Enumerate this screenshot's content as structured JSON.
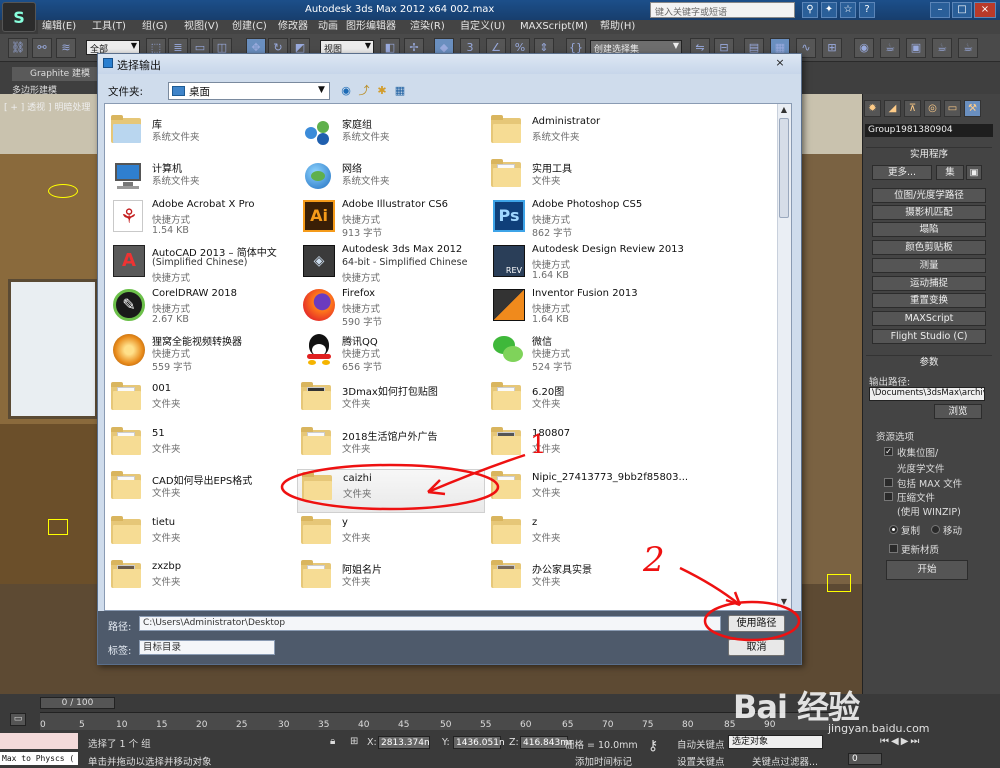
{
  "window": {
    "title": "Autodesk 3ds Max  2012 x64     002.max",
    "search_placeholder": "键入关键字或短语"
  },
  "menubar": {
    "items": [
      "编辑(E)",
      "工具(T)",
      "组(G)",
      "视图(V)",
      "创建(C)",
      "修改器",
      "动画",
      "图形编辑器",
      "渲染(R)",
      "自定义(U)",
      "MAXScript(M)",
      "帮助(H)"
    ]
  },
  "toolbar": {
    "selection_filter": "全部",
    "ref_coord": "视图",
    "named_selection": "创建选择集"
  },
  "ribbon": {
    "graphite_tab": "Graphite 建模",
    "poly_modeling": "多边形建模"
  },
  "viewport": {
    "label": "[ + ] 透视 ] 明暗处理"
  },
  "command_panel": {
    "object_name": "Group1981380904",
    "utilities_title": "实用程序",
    "more_button": "更多...",
    "sets_button": "集",
    "utility_buttons": [
      "位图/光度学路径",
      "摄影机匹配",
      "塌陷",
      "颜色剪贴板",
      "测量",
      "运动捕捉",
      "重置变换",
      "MAXScript",
      "Flight Studio (C)"
    ],
    "params_title": "参数",
    "output_path_label": "输出路径:",
    "output_path_value": "\\Documents\\3dsMax\\archives",
    "browse_button": "浏览",
    "resource_options_label": "资源选项",
    "collect_bitmaps": "收集位图/",
    "photometric_files": "光度学文件",
    "include_max_file": "包括 MAX 文件",
    "compress_files": "压缩文件",
    "use_winzip": "(使用 WINZIP)",
    "copy_radio": "复制",
    "move_radio": "移动",
    "update_materials": "更新材质",
    "start_button": "开始"
  },
  "dialog": {
    "title": "选择输出",
    "folder_label": "文件夹:",
    "folder_value": "桌面",
    "path_label": "路径:",
    "path_value": "C:\\Users\\Administrator\\Desktop",
    "use_path_button": "使用路径",
    "label_label": "标签:",
    "label_value": "目标目录",
    "cancel_button": "取消",
    "items": [
      {
        "name": "库",
        "l2": "系统文件夹",
        "l3": "",
        "icon": "library-folder-icon"
      },
      {
        "name": "家庭组",
        "l2": "系统文件夹",
        "l3": "",
        "icon": "homegroup-icon"
      },
      {
        "name": "Administrator",
        "l2": "系统文件夹",
        "l3": "",
        "icon": "user-folder-icon"
      },
      {
        "name": "计算机",
        "l2": "系统文件夹",
        "l3": "",
        "icon": "computer-icon"
      },
      {
        "name": "网络",
        "l2": "系统文件夹",
        "l3": "",
        "icon": "network-icon"
      },
      {
        "name": "实用工具",
        "l2": "文件夹",
        "l3": "",
        "icon": "folder-icon"
      },
      {
        "name": "Adobe Acrobat X Pro",
        "l2": "快捷方式",
        "l3": "1.54 KB",
        "icon": "acrobat-icon"
      },
      {
        "name": "Adobe Illustrator CS6",
        "l2": "快捷方式",
        "l3": "913 字节",
        "icon": "illustrator-icon"
      },
      {
        "name": "Adobe Photoshop CS5",
        "l2": "快捷方式",
        "l3": "862 字节",
        "icon": "photoshop-icon"
      },
      {
        "name": "AutoCAD 2013 – 简体中文",
        "l2": "(Simplified Chinese)",
        "l3": "快捷方式",
        "icon": "autocad-icon"
      },
      {
        "name": "Autodesk 3ds Max 2012",
        "l2": "64-bit - Simplified Chinese",
        "l3": "快捷方式",
        "icon": "3dsmax-icon"
      },
      {
        "name": "Autodesk Design Review 2013",
        "l2": "快捷方式",
        "l3": "1.64 KB",
        "icon": "design-review-icon"
      },
      {
        "name": "CorelDRAW 2018",
        "l2": "快捷方式",
        "l3": "2.67 KB",
        "icon": "coreldraw-icon"
      },
      {
        "name": "Firefox",
        "l2": "快捷方式",
        "l3": "590 字节",
        "icon": "firefox-icon"
      },
      {
        "name": "Inventor Fusion 2013",
        "l2": "快捷方式",
        "l3": "1.64 KB",
        "icon": "inventor-fusion-icon"
      },
      {
        "name": "狸窝全能视频转换器",
        "l2": "快捷方式",
        "l3": "559 字节",
        "icon": "video-converter-icon"
      },
      {
        "name": "腾讯QQ",
        "l2": "快捷方式",
        "l3": "656 字节",
        "icon": "qq-icon"
      },
      {
        "name": "微信",
        "l2": "快捷方式",
        "l3": "524 字节",
        "icon": "wechat-icon"
      },
      {
        "name": "001",
        "l2": "文件夹",
        "l3": "",
        "icon": "folder-icon"
      },
      {
        "name": "3Dmax如何打包贴图",
        "l2": "文件夹",
        "l3": "",
        "icon": "folder-icon"
      },
      {
        "name": "6.20图",
        "l2": "文件夹",
        "l3": "",
        "icon": "folder-icon"
      },
      {
        "name": "51",
        "l2": "文件夹",
        "l3": "",
        "icon": "folder-icon"
      },
      {
        "name": "2018生活馆户外广告",
        "l2": "文件夹",
        "l3": "",
        "icon": "folder-icon"
      },
      {
        "name": "180807",
        "l2": "文件夹",
        "l3": "",
        "icon": "folder-icon"
      },
      {
        "name": "CAD如何导出EPS格式",
        "l2": "文件夹",
        "l3": "",
        "icon": "folder-icon"
      },
      {
        "name": "caizhi",
        "l2": "文件夹",
        "l3": "",
        "icon": "folder-icon"
      },
      {
        "name": "Nipic_27413773_9bb2f85803...",
        "l2": "文件夹",
        "l3": "",
        "icon": "folder-icon"
      },
      {
        "name": "tietu",
        "l2": "文件夹",
        "l3": "",
        "icon": "folder-icon"
      },
      {
        "name": "y",
        "l2": "文件夹",
        "l3": "",
        "icon": "folder-icon"
      },
      {
        "name": "z",
        "l2": "文件夹",
        "l3": "",
        "icon": "folder-icon"
      },
      {
        "name": "zxzbp",
        "l2": "文件夹",
        "l3": "",
        "icon": "folder-icon"
      },
      {
        "name": "阿姐名片",
        "l2": "文件夹",
        "l3": "",
        "icon": "folder-icon"
      },
      {
        "name": "办公家具实景",
        "l2": "文件夹",
        "l3": "",
        "icon": "folder-icon"
      }
    ]
  },
  "timeline": {
    "frame_display": "0 / 100",
    "ticks": [
      "0",
      "5",
      "10",
      "15",
      "20",
      "25",
      "30",
      "35",
      "40",
      "45",
      "50",
      "55",
      "60",
      "65",
      "70",
      "75",
      "80",
      "85",
      "90"
    ]
  },
  "statusbar": {
    "maxscript_text": "Max to Physcs (",
    "selected_text": "选择了 1 个 组",
    "hint_text": "单击并拖动以选择并移动对象",
    "x_label": "X:",
    "x_value": "2813.374n",
    "y_label": "Y:",
    "y_value": "1436.051n",
    "z_label": "Z:",
    "z_value": "416.843mr",
    "grid_text": "栅格 = 10.0mm",
    "add_time_tag": "添加时间标记",
    "auto_key": "自动关键点",
    "set_key": "设置关键点",
    "key_filter": "关键点过滤器...",
    "anim_select": "选定对象",
    "frame_field": "0"
  },
  "annotations": {
    "mark_1": "1",
    "mark_2": "2",
    "watermark": "Bai 经验",
    "watermark_sub": "jingyan.baidu.com"
  }
}
